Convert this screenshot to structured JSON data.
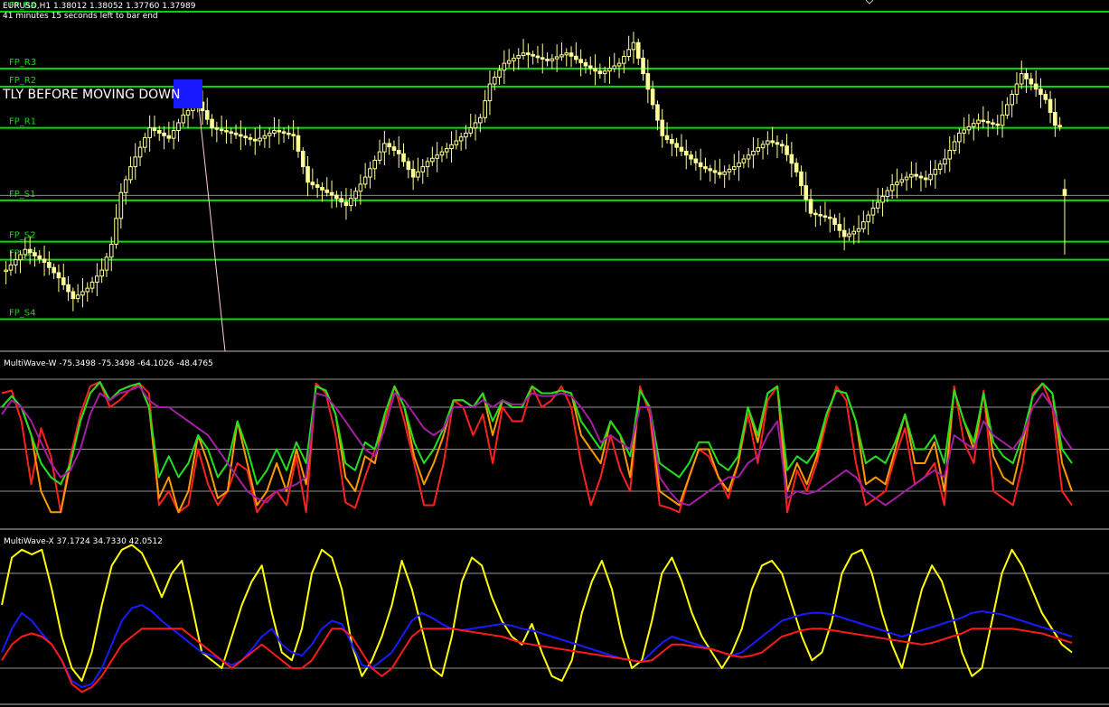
{
  "header": {
    "symbol_line": "EURUSD,H1  1.38012 1.38052 1.37760 1.37989",
    "timer_line": "41 minutes 15 seconds left to bar end"
  },
  "price_panel": {
    "alert_text": "TLY BEFORE MOVING DOWN",
    "alert_box_color": "#1919ff",
    "level_color": "#00e000",
    "candle_color": "#ffff99",
    "bid_line_color": "#8a8a8a",
    "levels": [
      {
        "name": "FP_R4",
        "label": "FP_R4",
        "price": 1.387
      },
      {
        "name": "FP_R3",
        "label": "FP_R3",
        "price": 1.3848
      },
      {
        "name": "FP_R2",
        "label": "FP_R2",
        "price": 1.3841
      },
      {
        "name": "FP_R1",
        "label": "FP_R1",
        "price": 1.3825
      },
      {
        "name": "FP_S1",
        "label": "FP_S1",
        "price": 1.3797
      },
      {
        "name": "FP_S2",
        "label": "FP_S2",
        "price": 1.3781
      },
      {
        "name": "FP_S3",
        "label": "FP_S3",
        "price": 1.3774
      },
      {
        "name": "FP_S4",
        "label": "FP_S4",
        "price": 1.3751
      }
    ]
  },
  "w_panel": {
    "title": "MultiWave-W -75.3498 -75.3498 -64.1026 -48.4765",
    "levels": [
      0,
      -20,
      -50,
      -80
    ]
  },
  "x_panel": {
    "title": "MultiWave-X 37.1724 34.7330 42.0512",
    "levels": [
      80,
      20
    ]
  },
  "chart_data": [
    {
      "type": "candlestick",
      "title": "EURUSD,H1  1.38012 1.38052 1.37760 1.37989",
      "ylim": [
        1.374,
        1.3871
      ],
      "last_bar": {
        "open": 1.38012,
        "high": 1.38052,
        "low": 1.3776,
        "close": 1.37989
      },
      "close_path": [
        [
          0,
          1.377
        ],
        [
          4,
          1.3778
        ],
        [
          8,
          1.3773
        ],
        [
          11,
          1.3767
        ],
        [
          14,
          1.3759
        ],
        [
          17,
          1.3763
        ],
        [
          20,
          1.377
        ],
        [
          22,
          1.378
        ],
        [
          24,
          1.38
        ],
        [
          26,
          1.381
        ],
        [
          30,
          1.3825
        ],
        [
          34,
          1.3821
        ],
        [
          37,
          1.383
        ],
        [
          40,
          1.3835
        ],
        [
          43,
          1.3825
        ],
        [
          47,
          1.3823
        ],
        [
          52,
          1.382
        ],
        [
          56,
          1.3824
        ],
        [
          60,
          1.3822
        ],
        [
          63,
          1.3804
        ],
        [
          68,
          1.3799
        ],
        [
          71,
          1.3795
        ],
        [
          75,
          1.3806
        ],
        [
          79,
          1.3819
        ],
        [
          82,
          1.3815
        ],
        [
          85,
          1.3806
        ],
        [
          88,
          1.3812
        ],
        [
          92,
          1.3817
        ],
        [
          96,
          1.3823
        ],
        [
          99,
          1.3829
        ],
        [
          101,
          1.3842
        ],
        [
          104,
          1.385
        ],
        [
          108,
          1.3854
        ],
        [
          113,
          1.3851
        ],
        [
          117,
          1.3854
        ],
        [
          121,
          1.3849
        ],
        [
          124,
          1.3846
        ],
        [
          128,
          1.385
        ],
        [
          131,
          1.3858
        ],
        [
          134,
          1.384
        ],
        [
          137,
          1.3822
        ],
        [
          141,
          1.3816
        ],
        [
          145,
          1.381
        ],
        [
          149,
          1.3807
        ],
        [
          152,
          1.381
        ],
        [
          156,
          1.3816
        ],
        [
          159,
          1.382
        ],
        [
          162,
          1.3818
        ],
        [
          165,
          1.3808
        ],
        [
          168,
          1.3792
        ],
        [
          172,
          1.379
        ],
        [
          175,
          1.3783
        ],
        [
          178,
          1.3786
        ],
        [
          181,
          1.3794
        ],
        [
          185,
          1.3803
        ],
        [
          189,
          1.3807
        ],
        [
          192,
          1.3805
        ],
        [
          196,
          1.3813
        ],
        [
          199,
          1.3823
        ],
        [
          203,
          1.3828
        ],
        [
          207,
          1.3826
        ],
        [
          210,
          1.3838
        ],
        [
          212,
          1.3846
        ],
        [
          214,
          1.3842
        ],
        [
          217,
          1.3836
        ],
        [
          219,
          1.3826
        ],
        [
          221,
          1.3825
        ]
      ]
    },
    {
      "type": "line",
      "title": "MultiWave-W -75.3498 -75.3498 -64.1026 -48.4765",
      "ylim": [
        -100,
        0
      ],
      "series": [
        {
          "color": "#ff2020",
          "values": [
            -10,
            -8,
            -30,
            -75,
            -35,
            -55,
            -95,
            -55,
            -25,
            -5,
            -2,
            -20,
            -15,
            -8,
            -3,
            -10,
            -90,
            -80,
            -95,
            -90,
            -50,
            -75,
            -90,
            -80,
            -60,
            -65,
            -95,
            -85,
            -80,
            -90,
            -55,
            -95,
            -3,
            -10,
            -40,
            -88,
            -92,
            -70,
            -50,
            -30,
            -5,
            -30,
            -60,
            -90,
            -90,
            -60,
            -15,
            -20,
            -40,
            -25,
            -60,
            -20,
            -30,
            -30,
            -5,
            -20,
            -15,
            -5,
            -20,
            -60,
            -90,
            -70,
            -40,
            -65,
            -80,
            -5,
            -25,
            -90,
            -92,
            -95,
            -70,
            -50,
            -55,
            -70,
            -85,
            -60,
            -25,
            -60,
            -15,
            -5,
            -95,
            -65,
            -80,
            -60,
            -30,
            -5,
            -15,
            -60,
            -90,
            -85,
            -80,
            -55,
            -35,
            -75,
            -70,
            -60,
            -90,
            -5,
            -45,
            -60,
            -8,
            -80,
            -85,
            -90,
            -60,
            -10,
            -3,
            -20,
            -80,
            -90
          ]
        },
        {
          "color": "#ff9900",
          "values": [
            -20,
            -12,
            -20,
            -40,
            -80,
            -95,
            -95,
            -60,
            -30,
            -10,
            -2,
            -15,
            -8,
            -5,
            -3,
            -20,
            -85,
            -70,
            -95,
            -80,
            -40,
            -60,
            -85,
            -80,
            -30,
            -60,
            -90,
            -80,
            -60,
            -80,
            -50,
            -75,
            -5,
            -8,
            -25,
            -70,
            -80,
            -55,
            -60,
            -25,
            -5,
            -20,
            -55,
            -75,
            -60,
            -40,
            -15,
            -15,
            -20,
            -10,
            -40,
            -15,
            -20,
            -20,
            -5,
            -10,
            -10,
            -8,
            -10,
            -40,
            -50,
            -60,
            -30,
            -40,
            -70,
            -8,
            -20,
            -80,
            -85,
            -90,
            -70,
            -50,
            -50,
            -70,
            -80,
            -60,
            -20,
            -45,
            -10,
            -5,
            -80,
            -60,
            -75,
            -55,
            -25,
            -8,
            -10,
            -30,
            -75,
            -70,
            -75,
            -50,
            -25,
            -60,
            -60,
            -45,
            -80,
            -8,
            -30,
            -50,
            -10,
            -55,
            -70,
            -75,
            -45,
            -12,
            -3,
            -10,
            -60,
            -80
          ]
        },
        {
          "color": "#20e020",
          "values": [
            -20,
            -12,
            -20,
            -40,
            -60,
            -70,
            -75,
            -60,
            -30,
            -10,
            -2,
            -15,
            -8,
            -5,
            -3,
            -20,
            -70,
            -55,
            -70,
            -60,
            -40,
            -50,
            -70,
            -60,
            -30,
            -50,
            -75,
            -65,
            -50,
            -65,
            -45,
            -60,
            -5,
            -8,
            -25,
            -60,
            -65,
            -45,
            -50,
            -25,
            -5,
            -20,
            -45,
            -60,
            -50,
            -35,
            -15,
            -15,
            -20,
            -10,
            -30,
            -15,
            -20,
            -20,
            -5,
            -10,
            -10,
            -8,
            -10,
            -30,
            -40,
            -50,
            -30,
            -40,
            -55,
            -8,
            -20,
            -60,
            -65,
            -70,
            -60,
            -45,
            -45,
            -60,
            -65,
            -55,
            -20,
            -40,
            -10,
            -5,
            -65,
            -55,
            -60,
            -50,
            -25,
            -8,
            -10,
            -30,
            -60,
            -55,
            -60,
            -45,
            -25,
            -50,
            -50,
            -40,
            -60,
            -8,
            -30,
            -45,
            -10,
            -45,
            -55,
            -60,
            -40,
            -12,
            -3,
            -10,
            -50,
            -60
          ]
        },
        {
          "color": "#a020a0",
          "values": [
            -25,
            -15,
            -20,
            -30,
            -45,
            -60,
            -70,
            -65,
            -50,
            -25,
            -10,
            -15,
            -10,
            -8,
            -5,
            -15,
            -20,
            -20,
            -25,
            -30,
            -35,
            -40,
            -50,
            -60,
            -70,
            -80,
            -85,
            -88,
            -80,
            -78,
            -75,
            -70,
            -10,
            -12,
            -20,
            -30,
            -40,
            -50,
            -55,
            -35,
            -10,
            -15,
            -25,
            -35,
            -40,
            -35,
            -20,
            -20,
            -20,
            -15,
            -20,
            -15,
            -18,
            -18,
            -10,
            -12,
            -12,
            -10,
            -12,
            -20,
            -30,
            -45,
            -40,
            -45,
            -50,
            -20,
            -20,
            -70,
            -80,
            -88,
            -90,
            -85,
            -80,
            -75,
            -70,
            -70,
            -60,
            -55,
            -40,
            -30,
            -85,
            -80,
            -82,
            -80,
            -75,
            -70,
            -65,
            -70,
            -80,
            -85,
            -90,
            -85,
            -80,
            -75,
            -70,
            -65,
            -70,
            -40,
            -45,
            -50,
            -30,
            -40,
            -45,
            -50,
            -40,
            -20,
            -10,
            -20,
            -40,
            -50
          ]
        }
      ]
    },
    {
      "type": "line",
      "title": "MultiWave-X 37.1724 34.7330 42.0512",
      "ylim": [
        0,
        100
      ],
      "series": [
        {
          "color": "#ffff00",
          "values": [
            60,
            90,
            95,
            92,
            95,
            70,
            40,
            20,
            12,
            30,
            60,
            85,
            95,
            98,
            93,
            80,
            65,
            80,
            88,
            60,
            30,
            25,
            20,
            40,
            60,
            75,
            85,
            55,
            30,
            25,
            45,
            80,
            95,
            90,
            70,
            35,
            15,
            25,
            40,
            60,
            88,
            70,
            45,
            20,
            15,
            40,
            75,
            90,
            85,
            65,
            50,
            40,
            35,
            48,
            30,
            15,
            12,
            25,
            55,
            75,
            88,
            70,
            40,
            20,
            25,
            50,
            80,
            90,
            75,
            55,
            40,
            30,
            20,
            30,
            45,
            70,
            85,
            88,
            80,
            60,
            40,
            25,
            30,
            50,
            80,
            92,
            95,
            80,
            55,
            35,
            20,
            45,
            70,
            85,
            75,
            55,
            30,
            15,
            20,
            50,
            80,
            95,
            85,
            70,
            55,
            45,
            35,
            30
          ]
        },
        {
          "color": "#1a1aff",
          "values": [
            30,
            45,
            55,
            50,
            42,
            35,
            25,
            12,
            8,
            10,
            20,
            35,
            50,
            58,
            60,
            56,
            50,
            45,
            40,
            35,
            30,
            28,
            25,
            22,
            25,
            32,
            40,
            45,
            35,
            30,
            28,
            35,
            45,
            50,
            48,
            35,
            22,
            20,
            25,
            30,
            40,
            50,
            55,
            52,
            48,
            45,
            44,
            45,
            46,
            47,
            48,
            47,
            45,
            44,
            42,
            40,
            38,
            36,
            34,
            32,
            30,
            28,
            26,
            25,
            24,
            30,
            36,
            40,
            38,
            36,
            34,
            32,
            30,
            28,
            30,
            35,
            40,
            45,
            50,
            52,
            54,
            55,
            55,
            54,
            52,
            50,
            48,
            46,
            44,
            42,
            40,
            42,
            44,
            46,
            48,
            50,
            52,
            55,
            56,
            55,
            54,
            52,
            50,
            48,
            46,
            44,
            42,
            40
          ]
        },
        {
          "color": "#ff1a1a",
          "values": [
            25,
            35,
            40,
            42,
            40,
            35,
            25,
            10,
            5,
            8,
            15,
            25,
            35,
            40,
            45,
            45,
            45,
            45,
            45,
            40,
            35,
            30,
            25,
            20,
            25,
            30,
            35,
            30,
            25,
            20,
            20,
            25,
            35,
            45,
            45,
            40,
            30,
            20,
            15,
            20,
            30,
            40,
            45,
            45,
            45,
            45,
            44,
            43,
            42,
            41,
            40,
            38,
            36,
            35,
            34,
            33,
            32,
            31,
            30,
            29,
            28,
            27,
            26,
            25,
            24,
            25,
            30,
            35,
            35,
            34,
            33,
            32,
            30,
            28,
            27,
            28,
            30,
            35,
            40,
            42,
            44,
            45,
            45,
            44,
            43,
            42,
            41,
            40,
            39,
            38,
            37,
            36,
            35,
            36,
            38,
            40,
            42,
            45,
            45,
            45,
            45,
            45,
            44,
            43,
            42,
            40,
            38,
            36
          ]
        }
      ]
    }
  ]
}
